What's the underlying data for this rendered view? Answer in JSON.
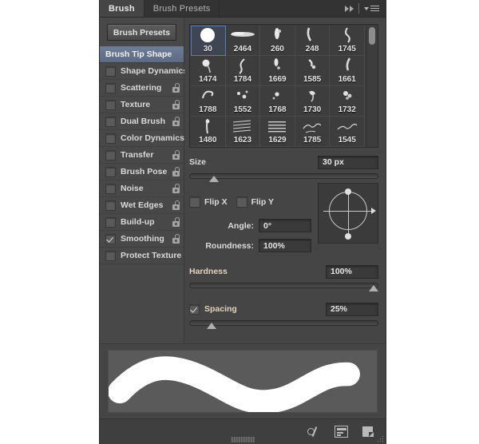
{
  "panel": {
    "tabs": [
      {
        "label": "Brush",
        "active": true
      },
      {
        "label": "Brush Presets",
        "active": false
      }
    ],
    "collapse_icon": "double-chevron-right-icon",
    "menu_icon": "panel-menu-icon"
  },
  "sidebar": {
    "presets_button": "Brush Presets",
    "items": [
      {
        "label": "Brush Tip Shape",
        "type": "header",
        "checked": false,
        "locked": false
      },
      {
        "label": "Shape Dynamics",
        "type": "checkbox",
        "checked": false,
        "locked": true
      },
      {
        "label": "Scattering",
        "type": "checkbox",
        "checked": false,
        "locked": true
      },
      {
        "label": "Texture",
        "type": "checkbox",
        "checked": false,
        "locked": true
      },
      {
        "label": "Dual Brush",
        "type": "checkbox",
        "checked": false,
        "locked": true
      },
      {
        "label": "Color Dynamics",
        "type": "checkbox",
        "checked": false,
        "locked": true
      },
      {
        "label": "Transfer",
        "type": "checkbox",
        "checked": false,
        "locked": true
      },
      {
        "label": "Brush Pose",
        "type": "checkbox",
        "checked": false,
        "locked": true
      },
      {
        "label": "Noise",
        "type": "checkbox",
        "checked": false,
        "locked": true
      },
      {
        "label": "Wet Edges",
        "type": "checkbox",
        "checked": false,
        "locked": true
      },
      {
        "label": "Build-up",
        "type": "checkbox",
        "checked": false,
        "locked": true
      },
      {
        "label": "Smoothing",
        "type": "checkbox",
        "checked": true,
        "locked": true
      },
      {
        "label": "Protect Texture",
        "type": "checkbox",
        "checked": false,
        "locked": true
      }
    ]
  },
  "brush_grid": {
    "selected_index": 0,
    "cells": [
      {
        "size": "30",
        "shape": "round"
      },
      {
        "size": "2464",
        "shape": "smear"
      },
      {
        "size": "260",
        "shape": "splat"
      },
      {
        "size": "248",
        "shape": "hook"
      },
      {
        "size": "1745",
        "shape": "figure"
      },
      {
        "size": "1474",
        "shape": "blob"
      },
      {
        "size": "1784",
        "shape": "spray"
      },
      {
        "size": "1669",
        "shape": "drip"
      },
      {
        "size": "1585",
        "shape": "splash"
      },
      {
        "size": "1661",
        "shape": "streak"
      },
      {
        "size": "1788",
        "shape": "swirl"
      },
      {
        "size": "1552",
        "shape": "scatter"
      },
      {
        "size": "1768",
        "shape": "fleck"
      },
      {
        "size": "1730",
        "shape": "bird"
      },
      {
        "size": "1732",
        "shape": "cluster"
      },
      {
        "size": "1480",
        "shape": "stem"
      },
      {
        "size": "1623",
        "shape": "texture"
      },
      {
        "size": "1629",
        "shape": "grain"
      },
      {
        "size": "1785",
        "shape": "script"
      },
      {
        "size": "1545",
        "shape": "signature"
      }
    ],
    "scrollbar": "vertical-scrollbar"
  },
  "controls": {
    "size": {
      "label": "Size",
      "value": "30 px",
      "slider_pct": 13
    },
    "flip_x": {
      "label": "Flip X",
      "checked": false
    },
    "flip_y": {
      "label": "Flip Y",
      "checked": false
    },
    "angle": {
      "label": "Angle:",
      "value": "0°"
    },
    "roundness": {
      "label": "Roundness:",
      "value": "100%"
    },
    "hardness": {
      "label": "Hardness",
      "value": "100%",
      "slider_pct": 100
    },
    "spacing": {
      "label": "Spacing",
      "value": "25%",
      "checked": true,
      "slider_pct": 12
    }
  },
  "footer": {
    "icons": [
      {
        "name": "toggle-brush-panel-icon"
      },
      {
        "name": "create-brush-preset-icon"
      },
      {
        "name": "new-brush-icon"
      }
    ],
    "resize_grip": "resize-grip"
  }
}
